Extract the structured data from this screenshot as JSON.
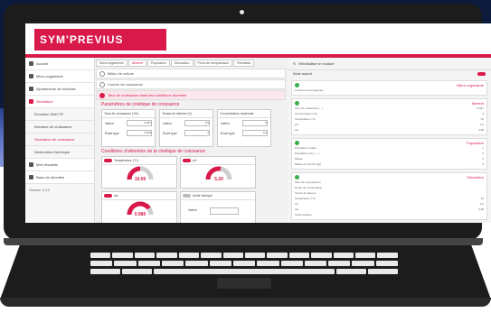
{
  "app": {
    "logo": "SYM'PREVIUS"
  },
  "sidebar": {
    "items": [
      {
        "label": "Accueil"
      },
      {
        "label": "Micro-organisme"
      },
      {
        "label": "Ajustements de modèles"
      },
      {
        "label": "Simulation"
      },
      {
        "label": "Évolution INACTP"
      },
      {
        "label": "Interface de croissance"
      },
      {
        "label": "Simulation de croissance"
      },
      {
        "label": "Destruction thermique"
      },
      {
        "label": "Mes résultats"
      },
      {
        "label": "Base de données"
      }
    ],
    "version": "Version 3.4.0"
  },
  "breadcrumbs": [
    "Micro-organisme",
    "Aliment",
    "Population",
    "Simulation",
    "Point de comparaison",
    "Résultats"
  ],
  "options": [
    {
      "label": "Milieu de culture"
    },
    {
      "label": "Courbe de croissance"
    },
    {
      "label": "Taux de croissance dans des conditions données"
    }
  ],
  "kinetic": {
    "title": "Paramètres de cinétique de croissance",
    "boxes": [
      {
        "header": "Taux de croissance (1/h)",
        "val_label": "Valeur",
        "val": "0.037",
        "sd_label": "Écart type",
        "sd": "0.004"
      },
      {
        "header": "Temps de latence (h)",
        "val_label": "Valeur",
        "val": "0.9",
        "sd_label": "Écart type",
        "sd": "2"
      },
      {
        "header": "Concentration maximale",
        "val_label": "Valeur",
        "val": "9",
        "sd_label": "Écart type",
        "sd": "0.4"
      }
    ]
  },
  "conditions": {
    "title": "Conditions d'obtention de la cinétique de croissance",
    "boxes": [
      {
        "label": "Température (°C)",
        "value": "10.00",
        "fraction": 0.5
      },
      {
        "label": "pH",
        "value": "5.20",
        "fraction": 0.55
      },
      {
        "label": "aw",
        "value": "0.980",
        "fraction": 0.8
      },
      {
        "label": "Acide lactique",
        "input_label": "Valeur"
      }
    ]
  },
  "right_panel": {
    "header": "Réinitialiser le module",
    "mode": "Mode avancé",
    "blocks": [
      {
        "title": "Micro-organisme",
        "lines": [
          {
            "k": "Listeria monocytogenes",
            "v": ""
          }
        ]
      },
      {
        "title": "Aliment",
        "lines": [
          {
            "k": "Taux de croissance (...)",
            "v": "0.037"
          },
          {
            "k": "Concentration max",
            "v": "9"
          },
          {
            "k": "Température (°C)",
            "v": "10"
          },
          {
            "k": "pH",
            "v": "5.2"
          },
          {
            "k": "aw",
            "v": "0.98"
          }
        ]
      },
      {
        "title": "Population",
        "lines": [
          {
            "k": "Population initiale",
            "v": "1"
          },
          {
            "k": "Population préc. (...)",
            "v": "0"
          },
          {
            "k": "Masse",
            "v": "0"
          },
          {
            "k": "Masse du produit (kg)",
            "v": "0"
          }
        ]
      },
      {
        "title": "Simulation",
        "lines": [
          {
            "k": "Taux de comparaison",
            "v": ""
          },
          {
            "k": "Durée de conservation",
            "v": ""
          },
          {
            "k": "Temps de latence",
            "v": ""
          },
          {
            "k": "Température (°C)",
            "v": "10"
          },
          {
            "k": "pH",
            "v": "5.2"
          },
          {
            "k": "aw",
            "v": "0.98"
          },
          {
            "k": "Acide lactique",
            "v": ""
          }
        ]
      }
    ]
  },
  "colors": {
    "accent": "#d9194a",
    "ok": "#3cae4f"
  }
}
